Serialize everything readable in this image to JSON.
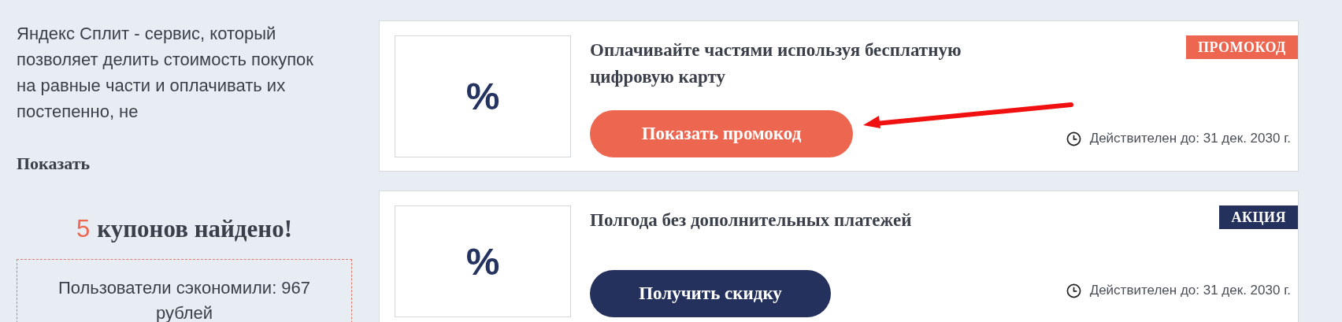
{
  "sidebar": {
    "description": "Яндекс Сплит - сервис, который позволяет делить стоимость покупок на равные части и оплачивать их постепенно, не",
    "show_more": "Показать",
    "coupons_count": "5",
    "coupons_label": "купонов найдено!",
    "savings": "Пользователи сэкономили: 967 рублей"
  },
  "coupons": [
    {
      "image_text": "%",
      "title": "Оплачивайте частями используя бесплатную цифровую карту",
      "badge": {
        "label": "ПРОМОКОД",
        "kind": "promo"
      },
      "button": {
        "label": "Показать промокод",
        "kind": "promo"
      },
      "valid_until": "Действителен до: 31 дек. 2030 г.",
      "highlighted": true
    },
    {
      "image_text": "%",
      "title": "Полгода без дополнительных платежей",
      "badge": {
        "label": "АКЦИЯ",
        "kind": "deal"
      },
      "button": {
        "label": "Получить скидку",
        "kind": "deal"
      },
      "valid_until": "Действителен до: 31 дек. 2030 г.",
      "highlighted": false
    }
  ]
}
